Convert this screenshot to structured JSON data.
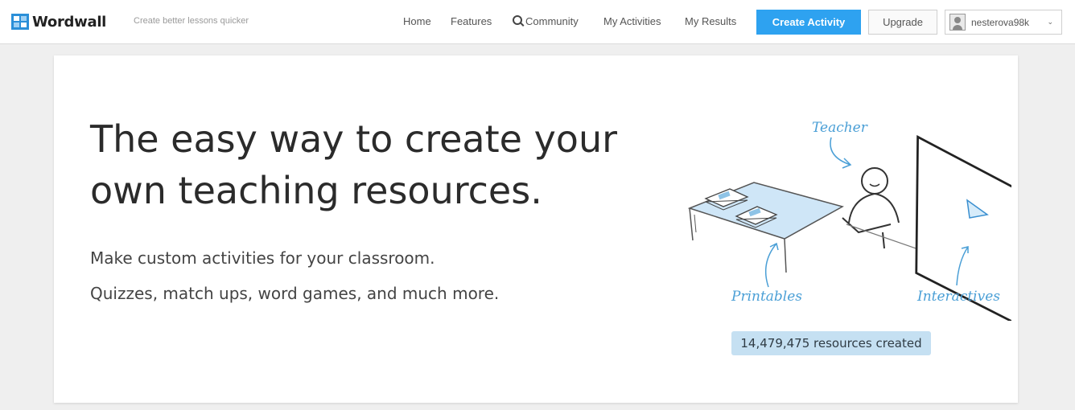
{
  "brand": {
    "name": "Wordwall",
    "tagline": "Create better lessons quicker"
  },
  "nav": {
    "items": [
      {
        "label": "Home"
      },
      {
        "label": "Features"
      },
      {
        "label": "Community",
        "icon": "search-icon"
      },
      {
        "label": "My Activities"
      },
      {
        "label": "My Results"
      }
    ],
    "create_label": "Create Activity",
    "upgrade_label": "Upgrade",
    "username": "nesterova98k"
  },
  "hero": {
    "headline_line1": "The easy way to create your",
    "headline_line2": "own teaching resources.",
    "sub1": "Make custom activities for your classroom.",
    "sub2": "Quizzes, match ups, word games, and much more.",
    "illustration_labels": {
      "teacher": "Teacher",
      "printables": "Printables",
      "interactives": "Interactives"
    },
    "resources_count": "14,479,475 resources created"
  },
  "colors": {
    "accent": "#2ea2f0",
    "illustration_blue": "#4a9fd6",
    "counter_bg": "#c5e0f2"
  }
}
